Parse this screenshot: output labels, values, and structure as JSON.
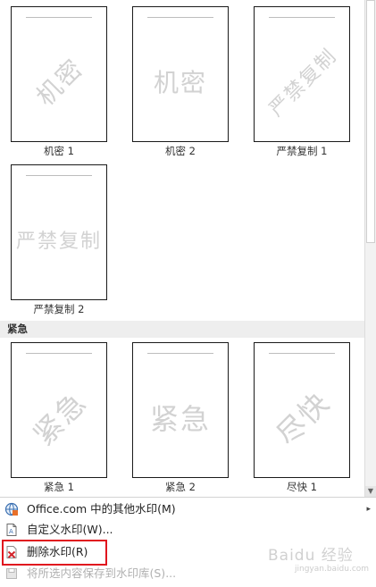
{
  "gallery": {
    "row1": [
      {
        "caption": "机密 1",
        "watermark": "机密"
      },
      {
        "caption": "机密 2",
        "watermark": "机密"
      },
      {
        "caption": "严禁复制 1",
        "watermark": "严禁复制"
      }
    ],
    "row2": [
      {
        "caption": "严禁复制 2",
        "watermark": "严禁复制"
      }
    ],
    "section_title": "紧急",
    "row3": [
      {
        "caption": "紧急 1",
        "watermark": "紧急"
      },
      {
        "caption": "紧急 2",
        "watermark": "紧急"
      },
      {
        "caption": "尽快 1",
        "watermark": "尽快"
      }
    ]
  },
  "menu": {
    "items": [
      {
        "label": "Office.com 中的其他水印(M)",
        "has_submenu": true,
        "enabled": true
      },
      {
        "label": "自定义水印(W)...",
        "has_submenu": false,
        "enabled": true
      },
      {
        "label": "删除水印(R)",
        "has_submenu": false,
        "enabled": true
      },
      {
        "label": "将所选内容保存到水印库(S)...",
        "has_submenu": false,
        "enabled": false
      }
    ],
    "submenu_arrow": "▸"
  },
  "scroll_arrow": "▼",
  "site_watermark": {
    "logo": "Baidu 经验",
    "sub": "jingyan.baidu.com"
  },
  "colors": {
    "highlight": "#e0141e",
    "watermark_text": "#d2d2d2"
  }
}
